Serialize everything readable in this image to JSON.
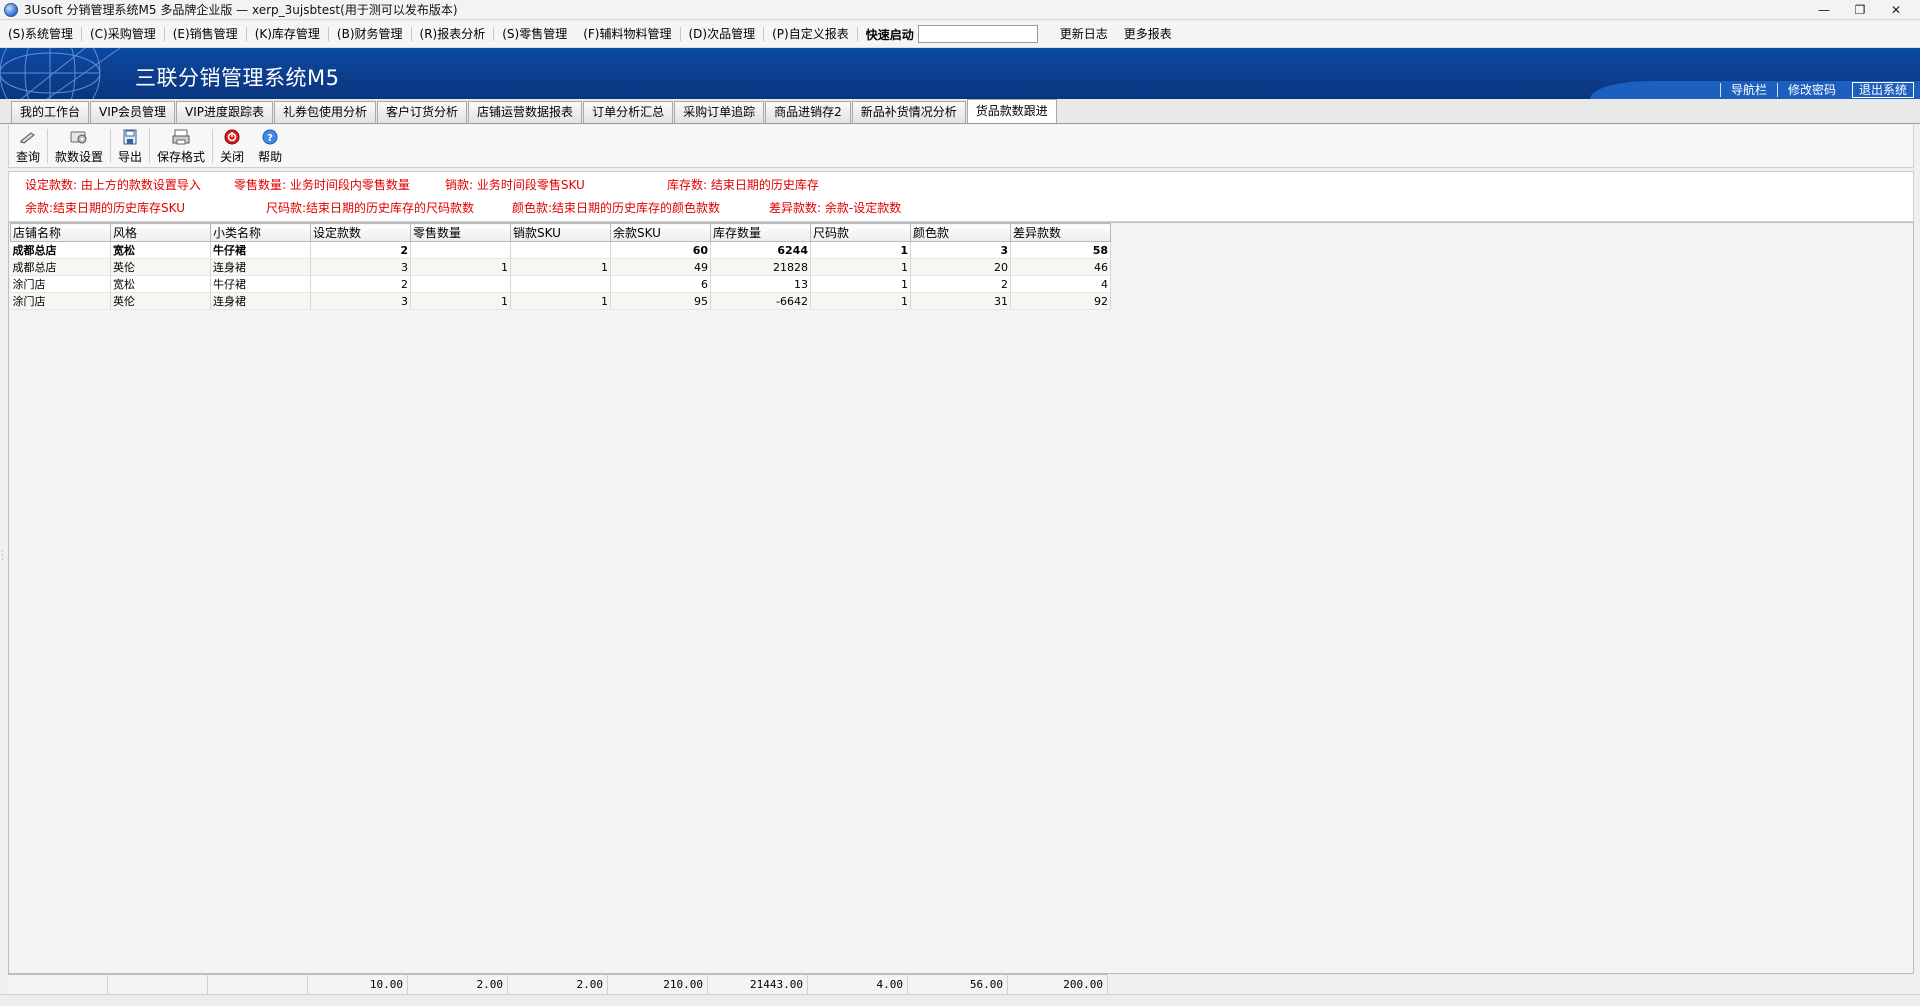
{
  "window": {
    "title": "3Usoft 分销管理系统M5 多品牌企业版 — xerp_3ujsbtest(用于测可以发布版本)",
    "controls": [
      "—",
      "❐",
      "✕"
    ]
  },
  "menu": {
    "items": [
      "(S)系统管理",
      "(C)采购管理",
      "(E)销售管理",
      "(K)库存管理",
      "(B)财务管理",
      "(R)报表分析",
      "(S)零售管理",
      "(F)辅料物料管理",
      "(D)次品管理",
      "(P)自定义报表"
    ],
    "quick_label": "快速启动",
    "quick_value": "",
    "extra": [
      "更新日志",
      "更多报表"
    ]
  },
  "banner": {
    "title": "三联分销管理系统M5",
    "links": [
      "导航栏",
      "修改密码",
      "退出系统"
    ]
  },
  "tabs": [
    "我的工作台",
    "VIP会员管理",
    "VIP进度跟踪表",
    "礼券包使用分析",
    "客户订货分析",
    "店铺运营数据报表",
    "订单分析汇总",
    "采购订单追踪",
    "商品进销存2",
    "新品补货情况分析",
    "货品款数跟进"
  ],
  "active_tab_index": 10,
  "toolbar": {
    "buttons": [
      {
        "label": "查询",
        "icon": "query-icon"
      },
      {
        "label": "款数设置",
        "icon": "settings-icon"
      },
      {
        "label": "导出",
        "icon": "export-icon"
      },
      {
        "label": "保存格式",
        "icon": "save-format-icon"
      },
      {
        "label": "关闭",
        "icon": "close-icon"
      },
      {
        "label": "帮助",
        "icon": "help-icon"
      }
    ]
  },
  "legend": {
    "row1": [
      "设定款数: 由上方的款数设置导入",
      "零售数量:  业务时间段内零售数量",
      "销款: 业务时间段零售SKU",
      "库存数:  结束日期的历史库存"
    ],
    "row2": [
      "余款:结束日期的历史库存SKU",
      "尺码款:结束日期的历史库存的尺码款数",
      "颜色款:结束日期的历史库存的颜色款数",
      "差异款数: 余款-设定款数"
    ]
  },
  "grid": {
    "columns": [
      "店铺名称",
      "风格",
      "小类名称",
      "设定款数",
      "零售数量",
      "销款SKU",
      "余款SKU",
      "库存数量",
      "尺码款",
      "颜色款",
      "差异款数"
    ],
    "rows": [
      [
        "成都总店",
        "宽松",
        "牛仔裙",
        "2",
        "",
        "",
        "60",
        "6244",
        "1",
        "3",
        "58"
      ],
      [
        "成都总店",
        "英伦",
        "连身裙",
        "3",
        "1",
        "1",
        "49",
        "21828",
        "1",
        "20",
        "46"
      ],
      [
        "涂门店",
        "宽松",
        "牛仔裙",
        "2",
        "",
        "",
        "6",
        "13",
        "1",
        "2",
        "4"
      ],
      [
        "涂门店",
        "英伦",
        "连身裙",
        "3",
        "1",
        "1",
        "95",
        "-6642",
        "1",
        "31",
        "92"
      ]
    ],
    "totals": [
      "",
      "",
      "",
      "10.00",
      "2.00",
      "2.00",
      "210.00",
      "21443.00",
      "4.00",
      "56.00",
      "200.00"
    ]
  }
}
